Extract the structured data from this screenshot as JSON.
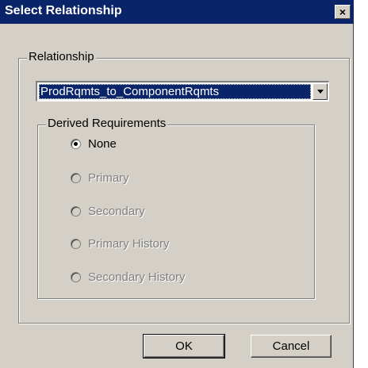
{
  "window": {
    "title": "Select Relationship",
    "close_label": "×"
  },
  "relationship": {
    "legend": "Relationship",
    "selected": "ProdRqmts_to_ComponentRqmts"
  },
  "derived": {
    "legend": "Derived Requirements",
    "options": [
      {
        "label": "None",
        "checked": true,
        "enabled": true
      },
      {
        "label": "Primary",
        "checked": false,
        "enabled": false
      },
      {
        "label": "Secondary",
        "checked": false,
        "enabled": false
      },
      {
        "label": "Primary History",
        "checked": false,
        "enabled": false
      },
      {
        "label": "Secondary History",
        "checked": false,
        "enabled": false
      }
    ]
  },
  "buttons": {
    "ok": "OK",
    "cancel": "Cancel"
  }
}
